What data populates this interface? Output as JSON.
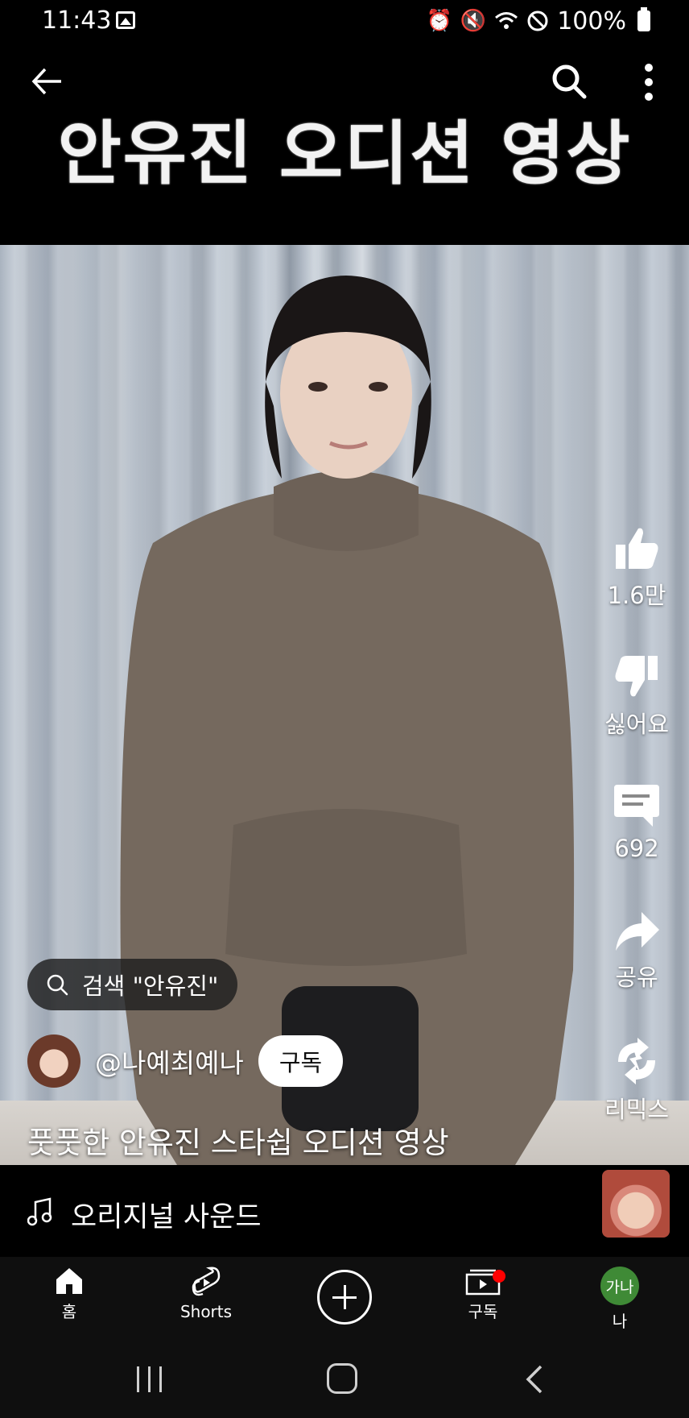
{
  "status_bar": {
    "time": "11:43",
    "battery": "100%",
    "icons": [
      "gallery-icon",
      "alarm-icon",
      "mute-icon",
      "wifi-icon",
      "do-not-disturb-icon",
      "battery-icon"
    ]
  },
  "header": {
    "overlay_title": "안유진 오디션 영상",
    "icons": [
      "back-arrow-icon",
      "search-icon",
      "more-vertical-icon"
    ]
  },
  "actions": {
    "like_count": "1.6만",
    "dislike_label": "싫어요",
    "comment_count": "692",
    "share_label": "공유",
    "remix_label": "리믹스"
  },
  "search_suggestion": {
    "text": "검색 \"안유진\""
  },
  "channel": {
    "handle": "@나예최예나",
    "subscribe_label": "구독"
  },
  "video": {
    "title": "풋풋한 안유진 스타쉽 오디션 영상"
  },
  "sound": {
    "label": "오리지널 사운드"
  },
  "bottom_nav": {
    "home": "홈",
    "shorts": "Shorts",
    "subscriptions": "구독",
    "me": "나",
    "me_avatar_text": "가나"
  },
  "colors": {
    "background": "#000000",
    "nav_background": "#0f0f0f",
    "notification_dot": "#ff0000",
    "avatar_green": "#3f8a36",
    "subscribe_button": "#ffffff"
  }
}
